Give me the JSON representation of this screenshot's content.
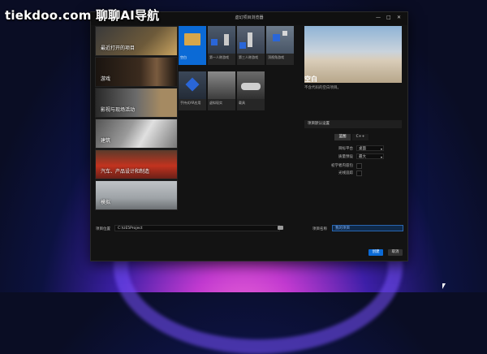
{
  "watermark": "tiekdoo.com 聊聊AI导航",
  "window": {
    "title": "虚幻项目浏览器",
    "min": "—",
    "max": "□",
    "close": "✕"
  },
  "categories": [
    {
      "label": "最近打开的项目"
    },
    {
      "label": "游戏"
    },
    {
      "label": "影视与现场活动"
    },
    {
      "label": "建筑"
    },
    {
      "label": "汽车、产品设计和制造"
    },
    {
      "label": "模拟"
    }
  ],
  "templates": [
    {
      "label": "空白"
    },
    {
      "label": "第一人称游戏"
    },
    {
      "label": "第三人称游戏"
    },
    {
      "label": "顶视角游戏"
    },
    {
      "label": "手持式AR应用"
    },
    {
      "label": "虚拟现实"
    },
    {
      "label": "载具"
    }
  ],
  "preview": {
    "title": "空白",
    "description": "不含代码的空白项目。"
  },
  "settings": {
    "header": "项目默认设置",
    "segments": [
      "蓝图",
      "C++"
    ],
    "rows": [
      {
        "label": "目标平台",
        "value": "桌面"
      },
      {
        "label": "质量预设",
        "value": "最大"
      }
    ],
    "checks": [
      {
        "label": "初学者内容包"
      },
      {
        "label": "光线追踪"
      }
    ]
  },
  "footer": {
    "location_label": "项目位置",
    "location_value": "C:\\UE5Project",
    "name_label": "项目名称",
    "name_value": "我的项目",
    "create": "创建",
    "cancel": "取消"
  }
}
